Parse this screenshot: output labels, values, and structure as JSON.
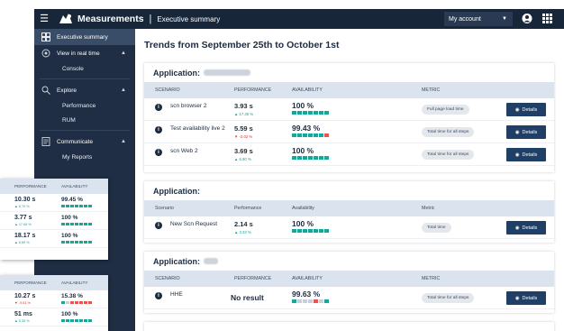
{
  "header": {
    "app_title": "Measurements",
    "separator": "|",
    "breadcrumb": "Executive summary",
    "account_label": "My account"
  },
  "sidebar": {
    "items": [
      {
        "label": "Executive summary",
        "icon": "dashboard-icon",
        "active": true
      },
      {
        "label": "View in real time",
        "icon": "realtime-icon",
        "expanded": true,
        "children": [
          "Console"
        ]
      },
      {
        "label": "Explore",
        "icon": "explore-icon",
        "expanded": true,
        "children": [
          "Performance",
          "RUM"
        ]
      },
      {
        "label": "Communicate",
        "icon": "communicate-icon",
        "expanded": true,
        "children": [
          "My Reports"
        ]
      }
    ]
  },
  "side_panels": [
    {
      "headers": [
        "PERFORMANCE",
        "AVAILABILITY"
      ],
      "rows": [
        {
          "perf": "10.30 s",
          "delta": "▲ 6.70 %",
          "trend": "up",
          "avail": "99.45 %",
          "squares": [
            "g",
            "g",
            "g",
            "g",
            "g",
            "g",
            "g"
          ]
        },
        {
          "perf": "3.77 s",
          "delta": "▲ 17.69 %",
          "trend": "up",
          "avail": "100 %",
          "squares": [
            "g",
            "g",
            "g",
            "g",
            "g",
            "g",
            "g"
          ]
        },
        {
          "perf": "18.17 s",
          "delta": "▲ 6.89 %",
          "trend": "up",
          "avail": "100 %",
          "squares": [
            "g",
            "g",
            "g",
            "g",
            "g",
            "g",
            "g"
          ]
        }
      ]
    },
    {
      "headers": [
        "PERFORMANCE",
        "AVAILABILITY"
      ],
      "rows": [
        {
          "perf": "10.27 s",
          "delta": "▼ -9.61 %",
          "trend": "down",
          "avail": "15.38 %",
          "squares": [
            "g",
            "l",
            "r",
            "r",
            "r",
            "r",
            "r"
          ]
        },
        {
          "perf": "51 ms",
          "delta": "▲ 5.35 %",
          "trend": "up",
          "avail": "100 %",
          "squares": [
            "g",
            "g",
            "g",
            "g",
            "g",
            "g",
            "g"
          ]
        }
      ]
    }
  ],
  "main": {
    "title": "Trends from September 25th to October 1st",
    "columns": {
      "scenario": "SCENARIO",
      "performance": "PERFORMANCE",
      "availability": "AVAILABILITY",
      "metric": "METRIC"
    },
    "details_label": "Details",
    "applications": [
      {
        "title": "Application:",
        "name_hidden": true,
        "header_style": "upper",
        "rows": [
          {
            "scenario": "scn browser 2",
            "perf": "3.93 s",
            "delta": "▲ 17.36 %",
            "trend": "up",
            "avail": "100 %",
            "squares": [
              "g",
              "g",
              "g",
              "g",
              "g",
              "g",
              "g"
            ],
            "metric": "Full page load time",
            "has_details": true
          },
          {
            "scenario": "Test availability live 2",
            "perf": "5.59 s",
            "delta": "▼ -2.02 %",
            "trend": "down",
            "avail": "99.43 %",
            "squares": [
              "g",
              "g",
              "g",
              "g",
              "g",
              "g",
              "r"
            ],
            "metric": "Total time for all steps",
            "has_details": true
          },
          {
            "scenario": "scn Web 2",
            "perf": "3.69 s",
            "delta": "▲ 6.90 %",
            "trend": "up",
            "avail": "100 %",
            "squares": [
              "g",
              "g",
              "g",
              "g",
              "g",
              "g",
              "g"
            ],
            "metric": "Total time for all steps",
            "has_details": true
          }
        ]
      },
      {
        "title": "Application:",
        "name_hidden": false,
        "header_style": "title",
        "columns": {
          "scenario": "Scenario",
          "performance": "Performance",
          "availability": "Availability",
          "metric": "Metric"
        },
        "rows": [
          {
            "scenario": "New Scn Request",
            "perf": "2.14 s",
            "delta": "▲ 3.33 %",
            "trend": "up",
            "avail": "100 %",
            "squares": [
              "g",
              "g",
              "g",
              "g",
              "g",
              "g",
              "g"
            ],
            "metric": "Total time",
            "has_details": true
          }
        ]
      },
      {
        "title": "Application:",
        "name_hidden": true,
        "header_style": "upper",
        "rows": [
          {
            "scenario": "HHE",
            "perf": "No result",
            "no_result": true,
            "avail": "99.63 %",
            "squares": [
              "t",
              "l",
              "l",
              "l",
              "r",
              "l",
              "g"
            ],
            "metric": "Total time for all steps",
            "has_details": true
          }
        ]
      }
    ]
  },
  "colors": {
    "topbar": "#18263a",
    "sidebar": "#1f2e44",
    "accent_green": "#1aa59b",
    "down_red": "#e03131",
    "details_button": "#1f3f66",
    "table_header": "#dbe4ee"
  }
}
